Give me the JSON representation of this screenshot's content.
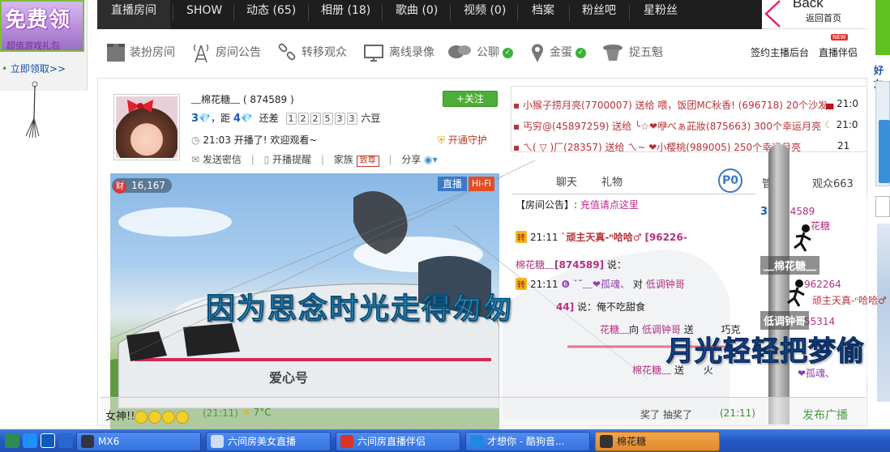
{
  "promo": {
    "title": "免费领",
    "subtitle": "超值游戏礼包",
    "claim_link": "立即领取>>"
  },
  "right_edge": {
    "label": "好友"
  },
  "nav": {
    "items": [
      "直播房间",
      "SHOW",
      "动态 (65)",
      "相册 (18)",
      "歌曲 (0)",
      "视频 (0)",
      "档案",
      "粉丝吧",
      "星粉丝"
    ],
    "back_title": "Back",
    "back_sub": "返回首页"
  },
  "toolbar": {
    "items": [
      "装扮房间",
      "房间公告",
      "转移观众",
      "离线录像",
      "公聊",
      "金蛋",
      "捉五魁"
    ],
    "anchor_backend": "签约主播后台",
    "companion": "直播伴侣",
    "new_badge": "NEW"
  },
  "profile": {
    "name": "﹏棉花糖﹏",
    "room_id": "( 874589 )",
    "follow_label": "+关注",
    "level_current": "3",
    "level_sep": "，距",
    "level_next": "4",
    "level_short": "还差",
    "level_digits": [
      "1",
      "2",
      "2",
      "5",
      "3",
      "3"
    ],
    "level_unit": "六豆",
    "live_time": "21:03",
    "live_msg": "开播了! 欢迎观看~",
    "guard_label": "开通守护",
    "actions": {
      "secret": "发送密信",
      "remind": "开播提醒",
      "family": "家族",
      "family_badge": "致尊",
      "share": "分享"
    }
  },
  "feed": [
    {
      "text": "小猴子捞月亮(7700007) 送给 喂，饭团MC秋香! (696718) 20个沙发",
      "time": "21:0"
    },
    {
      "text": "丐穷@(45897259) 送给 ╰☆❤咿べぁ茈妝(875663) 300个幸运月亮",
      "time": "21:0"
    },
    {
      "text": "ㄟ( ▽ )厂(28357) 送给 ㄟ~ ❤小樱桃(989005) 250个幸运月亮",
      "time": "21"
    }
  ],
  "video": {
    "wealth": "16,167",
    "wealth_icon": "财",
    "live_tag": "直播",
    "hifi_tag": "Hi-Fi",
    "lyric_main": "因为思念时光走得匆匆",
    "lyric_right": "月光轻轻把梦偷",
    "train_text": "爱心号"
  },
  "chat": {
    "tabs": [
      "聊天",
      "礼物"
    ],
    "p_badge": "P0",
    "notice_label": "【房间公告】:",
    "notice_link": "充值请点这里",
    "lines": [
      {
        "tag": "转",
        "time": "21:11",
        "user": "`顽主天真-ⁿ哈哈♂",
        "id": "[96226-"
      },
      {
        "user": "棉花糖﹏",
        "id": "[874589]",
        "said": "说："
      },
      {
        "tag": "转",
        "time": "21:11",
        "user": "❻ ˇ˜﹏❤孤魂、",
        "to": "对",
        "target": "低调钟哥"
      },
      {
        "id": "44]",
        "said": "说：俺不吃甜食"
      },
      {
        "user": "花糖﹏",
        "said": "向",
        "target": "低调钟哥",
        "verb": "送",
        "gift": "巧克"
      },
      {
        "user": "棉花糖﹏",
        "verb": "送",
        "gift": "火"
      }
    ]
  },
  "audience": {
    "tabs": [
      "管理",
      "观众663"
    ],
    "lines": [
      {
        "text": "3",
        "suffix": "74589"
      },
      {
        "text": "花糖"
      },
      {
        "text": "962264"
      },
      {
        "text": "顽主天真-ⁿ哈哈♂"
      },
      {
        "text": "55314"
      },
      {
        "text": "❤孤魂、"
      }
    ],
    "tags": [
      "﹏棉花糖﹏",
      "低调钟哥"
    ]
  },
  "bottom": {
    "left_text": "女神!!",
    "time1": "(21:11)",
    "weather": "7°C",
    "draw": "奖了   抽奖了",
    "time2": "(21:11)",
    "broadcast": "发布广播"
  },
  "taskbar": {
    "tasks": [
      "MX6",
      "六间房美女直播",
      "六间房直播伴侣",
      "才想你 - 酷狗音...",
      "棉花糖"
    ]
  },
  "colors": {
    "nav_bg": "#1e1e1e",
    "accent_green": "#4cae37",
    "taskbar": "#2458c4",
    "active_task": "#e08a2a"
  }
}
